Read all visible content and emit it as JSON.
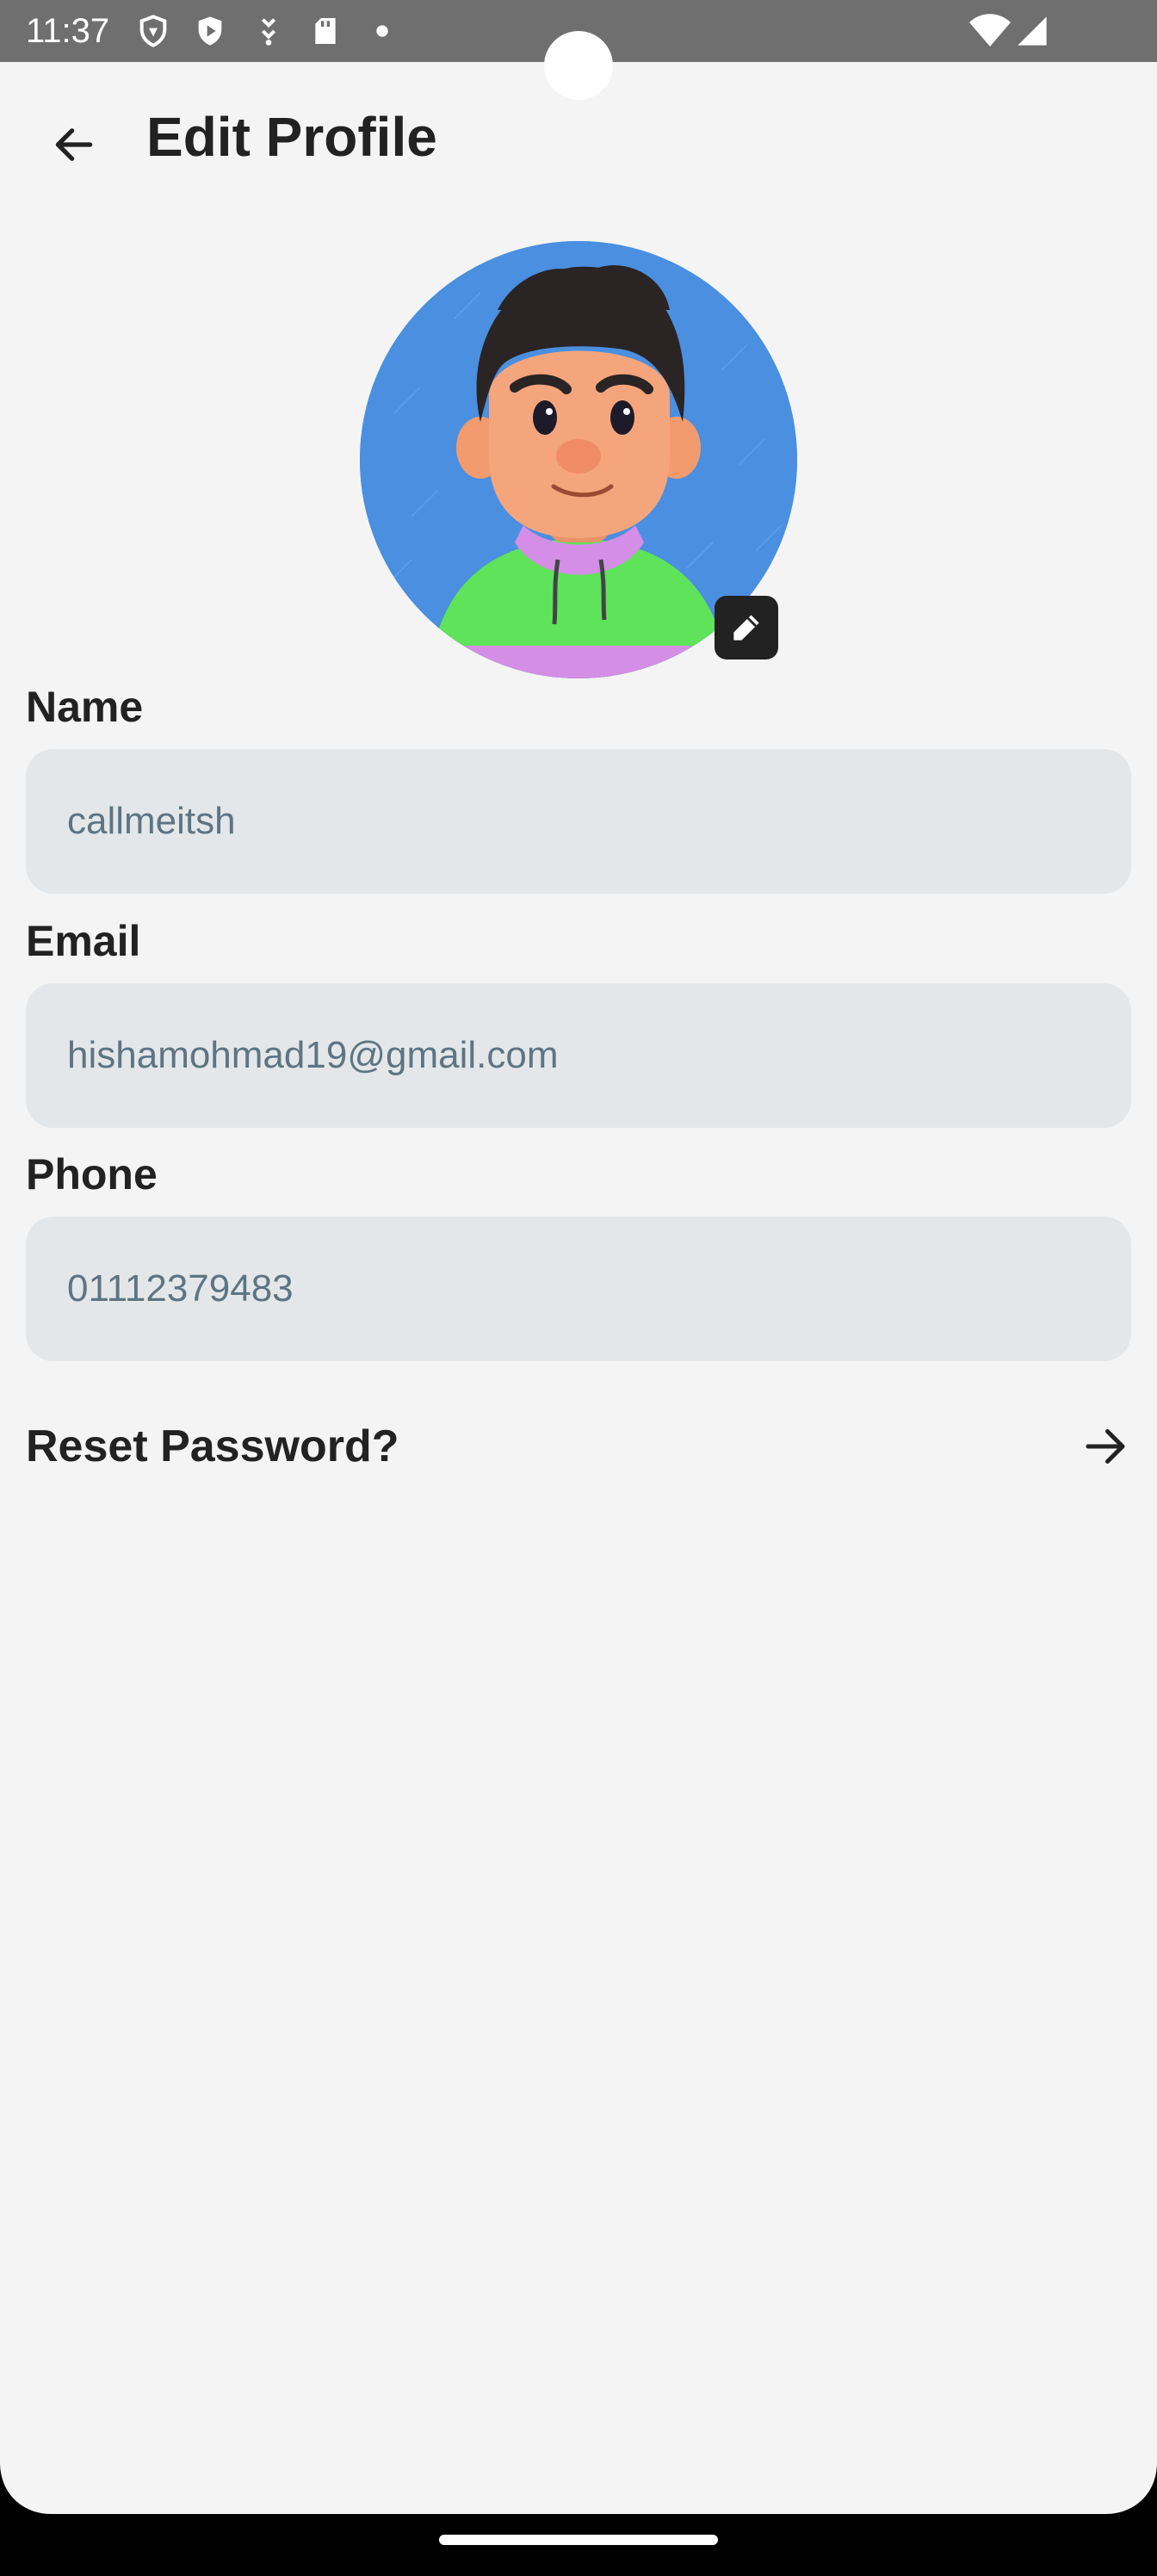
{
  "status_bar": {
    "time": "11:37",
    "left_icons": [
      "shield-outline-icon",
      "shield-play-icon",
      "download-icon",
      "sd-card-icon",
      "dot-icon"
    ],
    "right_icons": [
      "wifi-icon",
      "signal-icon"
    ]
  },
  "header": {
    "title": "Edit Profile",
    "back_icon": "arrow-left-icon"
  },
  "avatar": {
    "background_color": "#4a8fe0",
    "edit_icon": "pencil-icon"
  },
  "form": {
    "name": {
      "label": "Name",
      "value": "callmeitsh"
    },
    "email": {
      "label": "Email",
      "value": "hishamohmad19@gmail.com"
    },
    "phone": {
      "label": "Phone",
      "value": "01112379483"
    }
  },
  "reset": {
    "label": "Reset Password?",
    "icon": "arrow-right-icon"
  },
  "colors": {
    "background": "#f4f4f4",
    "field_background": "#e4e7e9",
    "field_text": "#5d7583",
    "status_bar": "#6f6f6f"
  }
}
